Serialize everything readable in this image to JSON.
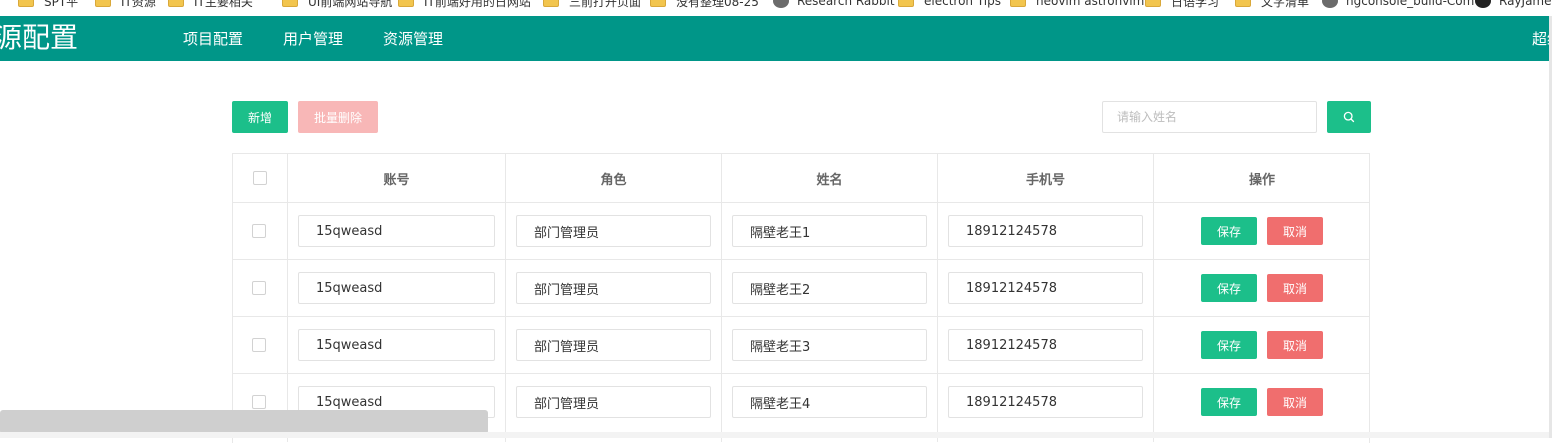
{
  "bookmarks": [
    {
      "label": "SPT平",
      "icon": "folder-icon"
    },
    {
      "label": "IT资源",
      "icon": "folder-icon"
    },
    {
      "label": "IT主要相关",
      "icon": "folder-icon"
    },
    {
      "label": "UI前端网站导航",
      "icon": "folder-icon"
    },
    {
      "label": "IT前端好用的日网站",
      "icon": "folder-icon"
    },
    {
      "label": "三前打开页面",
      "icon": "folder-icon"
    },
    {
      "label": "没有整理08-25",
      "icon": "folder-icon"
    },
    {
      "label": "Research Rabbit",
      "icon": "site-icon"
    },
    {
      "label": "electron Tips",
      "icon": "folder-icon"
    },
    {
      "label": "neovim astronvim",
      "icon": "folder-icon"
    },
    {
      "label": "日语学习",
      "icon": "folder-icon"
    },
    {
      "label": "文字清单",
      "icon": "folder-icon"
    },
    {
      "label": "ngconsole_build-Com",
      "icon": "site-icon"
    },
    {
      "label": "RayJames",
      "icon": "github-icon"
    }
  ],
  "header": {
    "brand": "源配置",
    "nav": [
      "项目配置",
      "用户管理",
      "资源管理"
    ],
    "user": "超级"
  },
  "toolbar": {
    "add_label": "新增",
    "batch_delete_label": "批量删除",
    "search_placeholder": "请输入姓名",
    "search_icon": "search-icon"
  },
  "table": {
    "columns": [
      "账号",
      "角色",
      "姓名",
      "手机号",
      "操作"
    ],
    "rows": [
      {
        "account": "15qweasd",
        "role": "部门管理员",
        "name": "隔壁老王1",
        "phone": "18912124578"
      },
      {
        "account": "15qweasd",
        "role": "部门管理员",
        "name": "隔壁老王2",
        "phone": "18912124578"
      },
      {
        "account": "15qweasd",
        "role": "部门管理员",
        "name": "隔壁老王3",
        "phone": "18912124578"
      },
      {
        "account": "15qweasd",
        "role": "部门管理员",
        "name": "隔壁老王4",
        "phone": "18912124578"
      }
    ],
    "save_label": "保存",
    "cancel_label": "取消"
  },
  "colors": {
    "header_bg": "#009688",
    "primary": "#1cbf8a",
    "danger": "#f06e6e",
    "danger_disabled": "#f8b7b7"
  }
}
